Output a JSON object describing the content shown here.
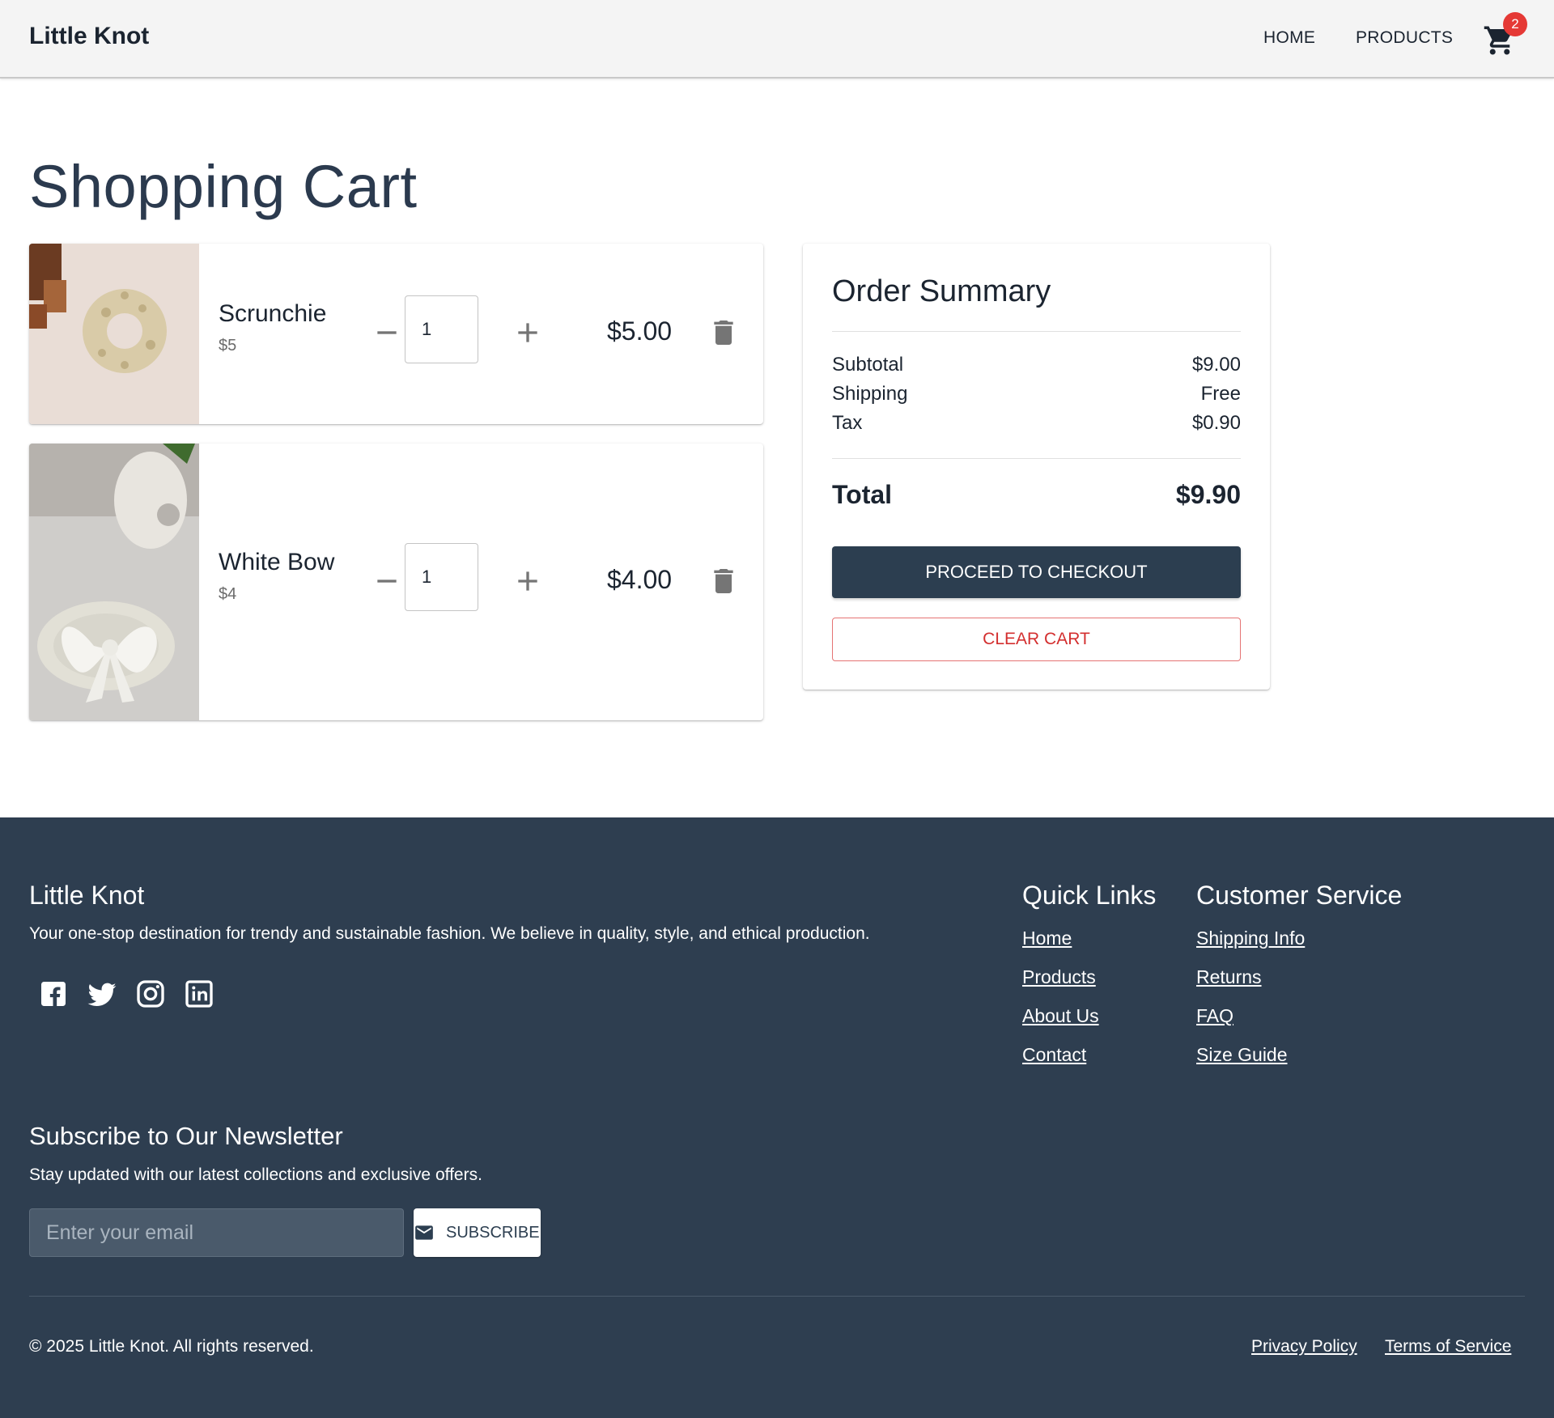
{
  "header": {
    "brand": "Little Knot",
    "nav": {
      "home": "HOME",
      "products": "PRODUCTS"
    },
    "cart_count": "2"
  },
  "page": {
    "title": "Shopping Cart"
  },
  "cart": {
    "items": [
      {
        "name": "Scrunchie",
        "unit_price": "$5",
        "quantity": "1",
        "line_total": "$5.00"
      },
      {
        "name": "White Bow",
        "unit_price": "$4",
        "quantity": "1",
        "line_total": "$4.00"
      }
    ]
  },
  "summary": {
    "title": "Order Summary",
    "subtotal_label": "Subtotal",
    "subtotal_value": "$9.00",
    "shipping_label": "Shipping",
    "shipping_value": "Free",
    "tax_label": "Tax",
    "tax_value": "$0.90",
    "total_label": "Total",
    "total_value": "$9.90",
    "checkout_label": "PROCEED TO CHECKOUT",
    "clear_label": "CLEAR CART"
  },
  "footer": {
    "brand": "Little Knot",
    "description": "Your one-stop destination for trendy and sustainable fashion. We believe in quality, style, and ethical production.",
    "social_icons": [
      "facebook-icon",
      "twitter-icon",
      "instagram-icon",
      "linkedin-icon"
    ],
    "quick_links": {
      "title": "Quick Links",
      "links": [
        "Home",
        "Products",
        "About Us",
        "Contact"
      ]
    },
    "customer_service": {
      "title": "Customer Service",
      "links": [
        "Shipping Info",
        "Returns",
        "FAQ",
        "Size Guide"
      ]
    },
    "newsletter": {
      "title": "Subscribe to Our Newsletter",
      "description": "Stay updated with our latest collections and exclusive offers.",
      "placeholder": "Enter your email",
      "button": "SUBSCRIBE"
    },
    "copyright": "© 2025 Little Knot. All rights reserved.",
    "legal": {
      "privacy": "Privacy Policy",
      "terms": "Terms of Service"
    }
  },
  "colors": {
    "primary": "#2c3e50",
    "footer_bg": "#2e3e50",
    "badge": "#e53935",
    "danger": "#d32f2f"
  }
}
